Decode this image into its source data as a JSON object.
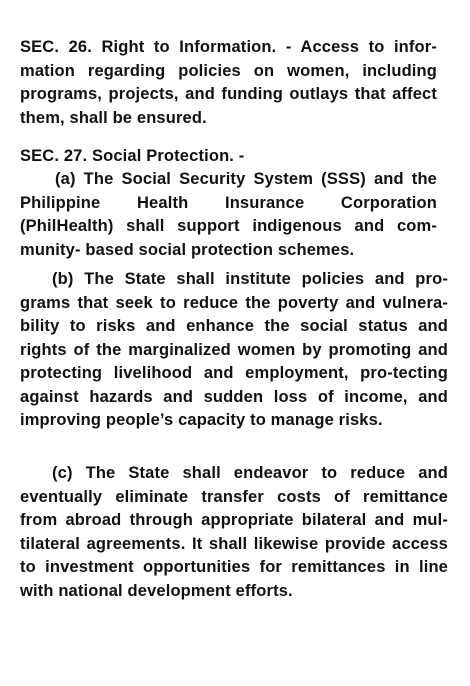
{
  "document": {
    "sec26": {
      "text": "SEC. 26. Right to Information. - Access to infor-mation regarding policies on women, including programs, projects, and funding outlays that affect them, shall be ensured."
    },
    "sec27": {
      "heading": "SEC. 27. Social Protection. -",
      "para_a": "(a) The Social Security System (SSS) and the Philippine Health Insurance Corporation (PhilHealth) shall support indigenous and com-munity- based social protection schemes.",
      "para_b": "(b) The State shall institute policies and pro-grams that seek to reduce the poverty and vulnera-bility to risks and enhance the social status and rights of the marginalized women by promoting and protecting livelihood and employment, pro-tecting against hazards and sudden loss of income, and improving people’s capacity to manage risks.",
      "para_c": "(c) The State shall endeavor to reduce and eventually eliminate transfer costs of remittance from abroad through appropriate bilateral and mul-tilateral agreements. It shall likewise provide access to investment opportunities for remittances in line with national development efforts."
    }
  }
}
